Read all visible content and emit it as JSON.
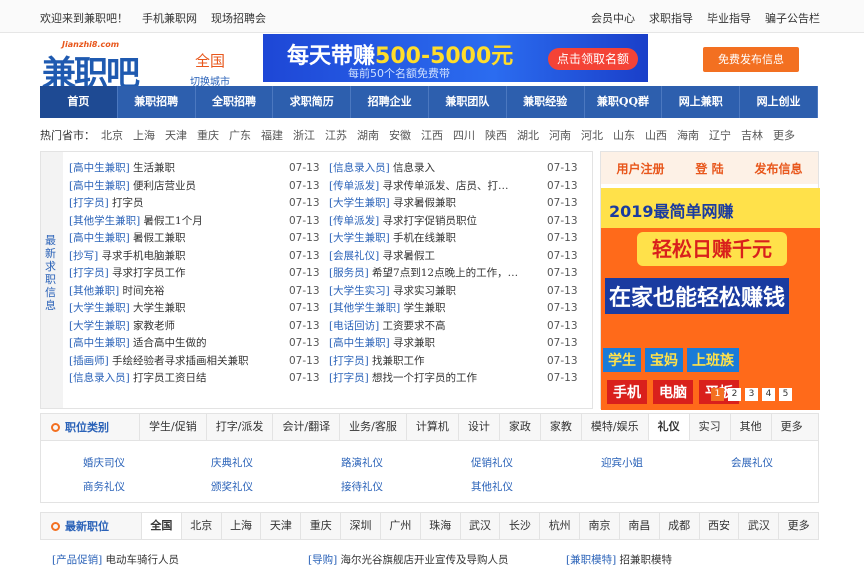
{
  "topbar": {
    "welcome": "欢迎来到兼职吧！",
    "mobile": "手机兼职网",
    "onsite": "现场招聘会",
    "links": [
      "会员中心",
      "求职指导",
      "毕业指导",
      "骗子公告栏"
    ]
  },
  "logo": {
    "text": "兼职吧",
    "domain": "Jianzhi8.com"
  },
  "city": {
    "name": "全国",
    "switch": "切换城市"
  },
  "banner": {
    "line1_a": "每天带赚",
    "line1_b": "500-5000元",
    "line2": "每前50个名额免费带",
    "button": "点击领取名额"
  },
  "publish_button": "免费发布信息",
  "nav": [
    "首页",
    "兼职招聘",
    "全职招聘",
    "求职简历",
    "招聘企业",
    "兼职团队",
    "兼职经验",
    "兼职QQ群",
    "网上兼职",
    "网上创业"
  ],
  "hot_cities": {
    "label": "热门省市：",
    "items": [
      "北京",
      "上海",
      "天津",
      "重庆",
      "广东",
      "福建",
      "浙江",
      "江苏",
      "湖南",
      "安徽",
      "江西",
      "四川",
      "陕西",
      "湖北",
      "河南",
      "河北",
      "山东",
      "山西",
      "海南",
      "辽宁",
      "吉林",
      "更多"
    ]
  },
  "latest_info_label": "最新求职信息",
  "jobs_left": [
    {
      "cat": "[高中生兼职]",
      "title": "生活兼职",
      "date": "07-13"
    },
    {
      "cat": "[高中生兼职]",
      "title": "便利店营业员",
      "date": "07-13"
    },
    {
      "cat": "[打字员]",
      "title": "打字员",
      "date": "07-13"
    },
    {
      "cat": "[其他学生兼职]",
      "title": "暑假工1个月",
      "date": "07-13"
    },
    {
      "cat": "[高中生兼职]",
      "title": "暑假工兼职",
      "date": "07-13"
    },
    {
      "cat": "[抄写]",
      "title": "寻求手机电脑兼职",
      "date": "07-13"
    },
    {
      "cat": "[打字员]",
      "title": "寻求打字员工作",
      "date": "07-13"
    },
    {
      "cat": "[其他兼职]",
      "title": "时间充裕",
      "date": "07-13"
    },
    {
      "cat": "[大学生兼职]",
      "title": "大学生兼职",
      "date": "07-13"
    },
    {
      "cat": "[大学生兼职]",
      "title": "家教老师",
      "date": "07-13"
    },
    {
      "cat": "[高中生兼职]",
      "title": "适合高中生做的",
      "date": "07-13"
    },
    {
      "cat": "[插画师]",
      "title": "手绘经验者寻求插画相关兼职",
      "date": "07-13"
    },
    {
      "cat": "[信息录入员]",
      "title": "打字员工资日结",
      "date": "07-13"
    }
  ],
  "jobs_right": [
    {
      "cat": "[信息录入员]",
      "title": "信息录入",
      "date": "07-13"
    },
    {
      "cat": "[传单派发]",
      "title": "寻求传单派发、店员、打…",
      "date": "07-13"
    },
    {
      "cat": "[大学生兼职]",
      "title": "寻求暑假兼职",
      "date": "07-13"
    },
    {
      "cat": "[传单派发]",
      "title": "寻求打字促销员职位",
      "date": "07-13"
    },
    {
      "cat": "[大学生兼职]",
      "title": "手机在线兼职",
      "date": "07-13"
    },
    {
      "cat": "[会展礼仪]",
      "title": "寻求暑假工",
      "date": "07-13"
    },
    {
      "cat": "[服务员]",
      "title": "希望7点到12点晚上的工作，…",
      "date": "07-13"
    },
    {
      "cat": "[大学生实习]",
      "title": "寻求实习兼职",
      "date": "07-13"
    },
    {
      "cat": "[其他学生兼职]",
      "title": "学生兼职",
      "date": "07-13"
    },
    {
      "cat": "[电话回访]",
      "title": "工资要求不高",
      "date": "07-13"
    },
    {
      "cat": "[高中生兼职]",
      "title": "寻求兼职",
      "date": "07-13"
    },
    {
      "cat": "[打字员]",
      "title": "找兼职工作",
      "date": "07-13"
    },
    {
      "cat": "[打字员]",
      "title": "想找一个打字员的工作",
      "date": "07-13"
    }
  ],
  "side_box": {
    "register": "用户注册",
    "login": "登 陆",
    "publish": "发布信息"
  },
  "ad": {
    "line1": "2019最简单网赚",
    "line2": "轻松日赚千元",
    "line3": "在家也能轻松赚钱",
    "tags": [
      "学生",
      "宝妈",
      "上班族"
    ],
    "devices": [
      "手机",
      "电脑",
      "平板"
    ],
    "pages": [
      "1",
      "2",
      "3",
      "4",
      "5"
    ]
  },
  "job_category": {
    "heading": "职位类别",
    "tabs": [
      "学生/促销",
      "打字/派发",
      "会计/翻译",
      "业务/客服",
      "计算机",
      "设计",
      "家政",
      "家教",
      "模特/娱乐",
      "礼仪",
      "实习",
      "其他",
      "更多"
    ],
    "active": "礼仪",
    "subcats_row1": [
      "婚庆司仪",
      "庆典礼仪",
      "路演礼仪",
      "促销礼仪",
      "迎宾小姐",
      "会展礼仪"
    ],
    "subcats_row2": [
      "商务礼仪",
      "颁奖礼仪",
      "接待礼仪",
      "其他礼仪"
    ]
  },
  "latest_jobs": {
    "heading": "最新职位",
    "tabs": [
      "全国",
      "北京",
      "上海",
      "天津",
      "重庆",
      "深圳",
      "广州",
      "珠海",
      "武汉",
      "长沙",
      "杭州",
      "南京",
      "南昌",
      "成都",
      "西安",
      "武汉",
      "更多"
    ],
    "active": "全国",
    "items": [
      {
        "cat": "[产品促销]",
        "title": "电动车骑行人员"
      },
      {
        "cat": "[导购]",
        "title": "海尔光谷旗舰店开业宣传及导购人员"
      },
      {
        "cat": "[兼职模特]",
        "title": "招兼职模特"
      }
    ]
  }
}
